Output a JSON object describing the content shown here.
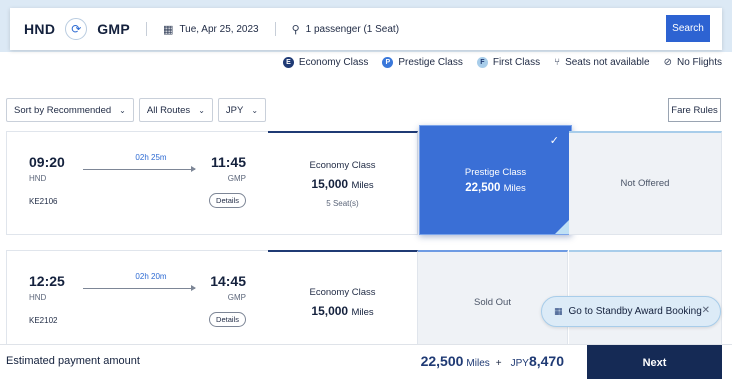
{
  "search": {
    "origin": "HND",
    "destination": "GMP",
    "date": "Tue, Apr 25, 2023",
    "passengers": "1 passenger (1 Seat)",
    "search_label": "Search"
  },
  "legend": {
    "economy": {
      "badge": "E",
      "label": "Economy Class",
      "color": "#1f3a74"
    },
    "prestige": {
      "badge": "P",
      "label": "Prestige Class",
      "color": "#3a78da"
    },
    "first": {
      "badge": "F",
      "label": "First Class",
      "color": "#a8cdea"
    },
    "unavailable": "Seats not available",
    "no_flights": "No Flights"
  },
  "filters": {
    "sort": "Sort by Recommended",
    "routes": "All Routes",
    "currency": "JPY",
    "fare_rules": "Fare Rules"
  },
  "flights": [
    {
      "dep_time": "09:20",
      "arr_time": "11:45",
      "duration": "02h 25m",
      "dep_code": "HND",
      "arr_code": "GMP",
      "flight_no": "KE2106",
      "details": "Details",
      "economy": {
        "label": "Economy Class",
        "miles": "15,000",
        "unit": "Miles",
        "seats": "5 Seat(s)"
      },
      "prestige": {
        "label": "Prestige Class",
        "miles": "22,500",
        "unit": "Miles",
        "selected": true
      },
      "first": {
        "status": "Not Offered"
      }
    },
    {
      "dep_time": "12:25",
      "arr_time": "14:45",
      "duration": "02h 20m",
      "dep_code": "HND",
      "arr_code": "GMP",
      "flight_no": "KE2102",
      "details": "Details",
      "economy": {
        "label": "Economy Class",
        "miles": "15,000",
        "unit": "Miles"
      },
      "prestige": {
        "status": "Sold Out"
      }
    }
  ],
  "standby": {
    "label": "Go to Standby Award Booking"
  },
  "footer": {
    "estimate_label": "Estimated payment amount",
    "miles": "22,500",
    "miles_unit": "Miles",
    "plus": "+",
    "currency": "JPY",
    "amount": "8,470",
    "next_label": "Next"
  }
}
